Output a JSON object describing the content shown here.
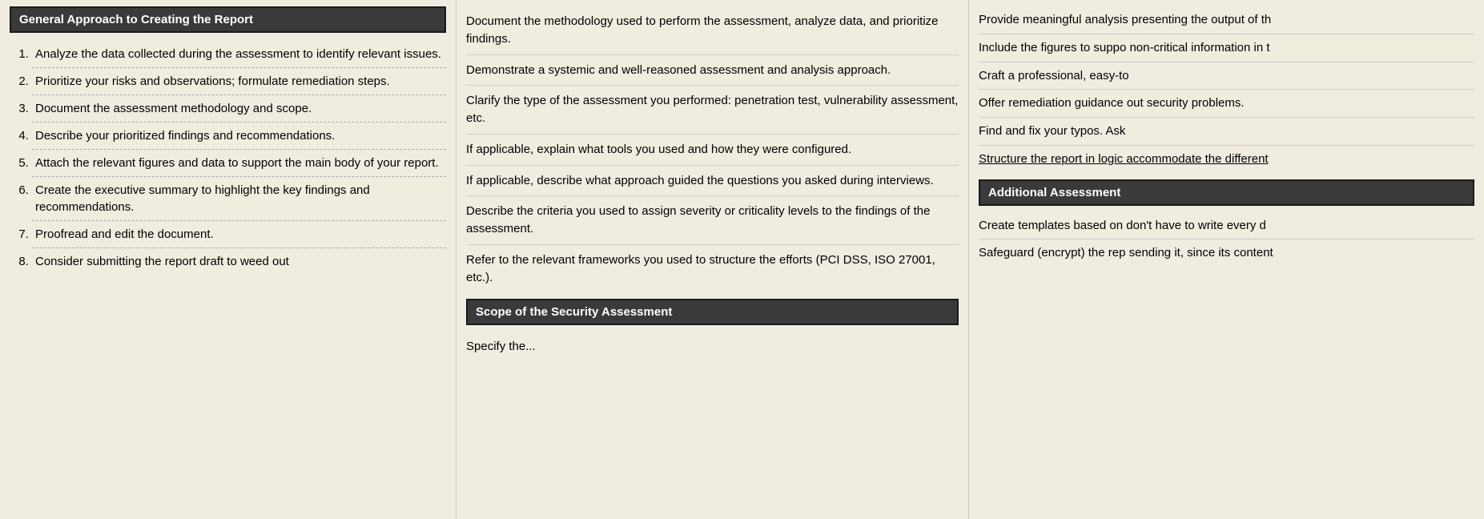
{
  "col1": {
    "header": "General Approach to Creating the Report",
    "items": [
      "Analyze the data collected during the assessment to identify relevant issues.",
      "Prioritize your risks and observations; formulate remediation steps.",
      "Document the assessment methodology and scope.",
      "Describe your prioritized findings and recommendations.",
      "Attach the relevant figures and data to support the main body of your report.",
      "Create the executive summary to highlight the key findings and recommendations.",
      "Proofread and edit the document.",
      "Consider submitting the report draft to weed out"
    ]
  },
  "col2": {
    "items": [
      "Document the methodology used to perform the assessment, analyze data, and prioritize findings.",
      "Demonstrate a systemic and well-reasoned assessment and analysis approach.",
      "Clarify the type of the assessment you performed: penetration test, vulnerability assessment, etc.",
      "If applicable, explain what tools you used and how they were configured.",
      "If applicable, describe what approach guided the questions you asked during interviews.",
      "Describe the criteria you used to assign severity or criticality levels to the findings of the assessment.",
      "Refer to the relevant frameworks you used to structure the efforts (PCI DSS, ISO 27001, etc.)."
    ],
    "subheader": "Scope of the Security Assessment",
    "subitems": [
      "Specify the..."
    ]
  },
  "col3": {
    "items": [
      "Provide meaningful analysis presenting the output of th",
      "Include the figures to suppo non-critical information in t",
      "Craft a professional, easy-to",
      "Offer remediation guidance out security problems.",
      "Find and fix your typos. Ask",
      "Structure the report in logic accommodate the different"
    ],
    "subheader": "Additional Assessment",
    "subitems": [
      "Create templates based on don't have to write every d",
      "Safeguard (encrypt) the rep sending it, since its content"
    ]
  }
}
